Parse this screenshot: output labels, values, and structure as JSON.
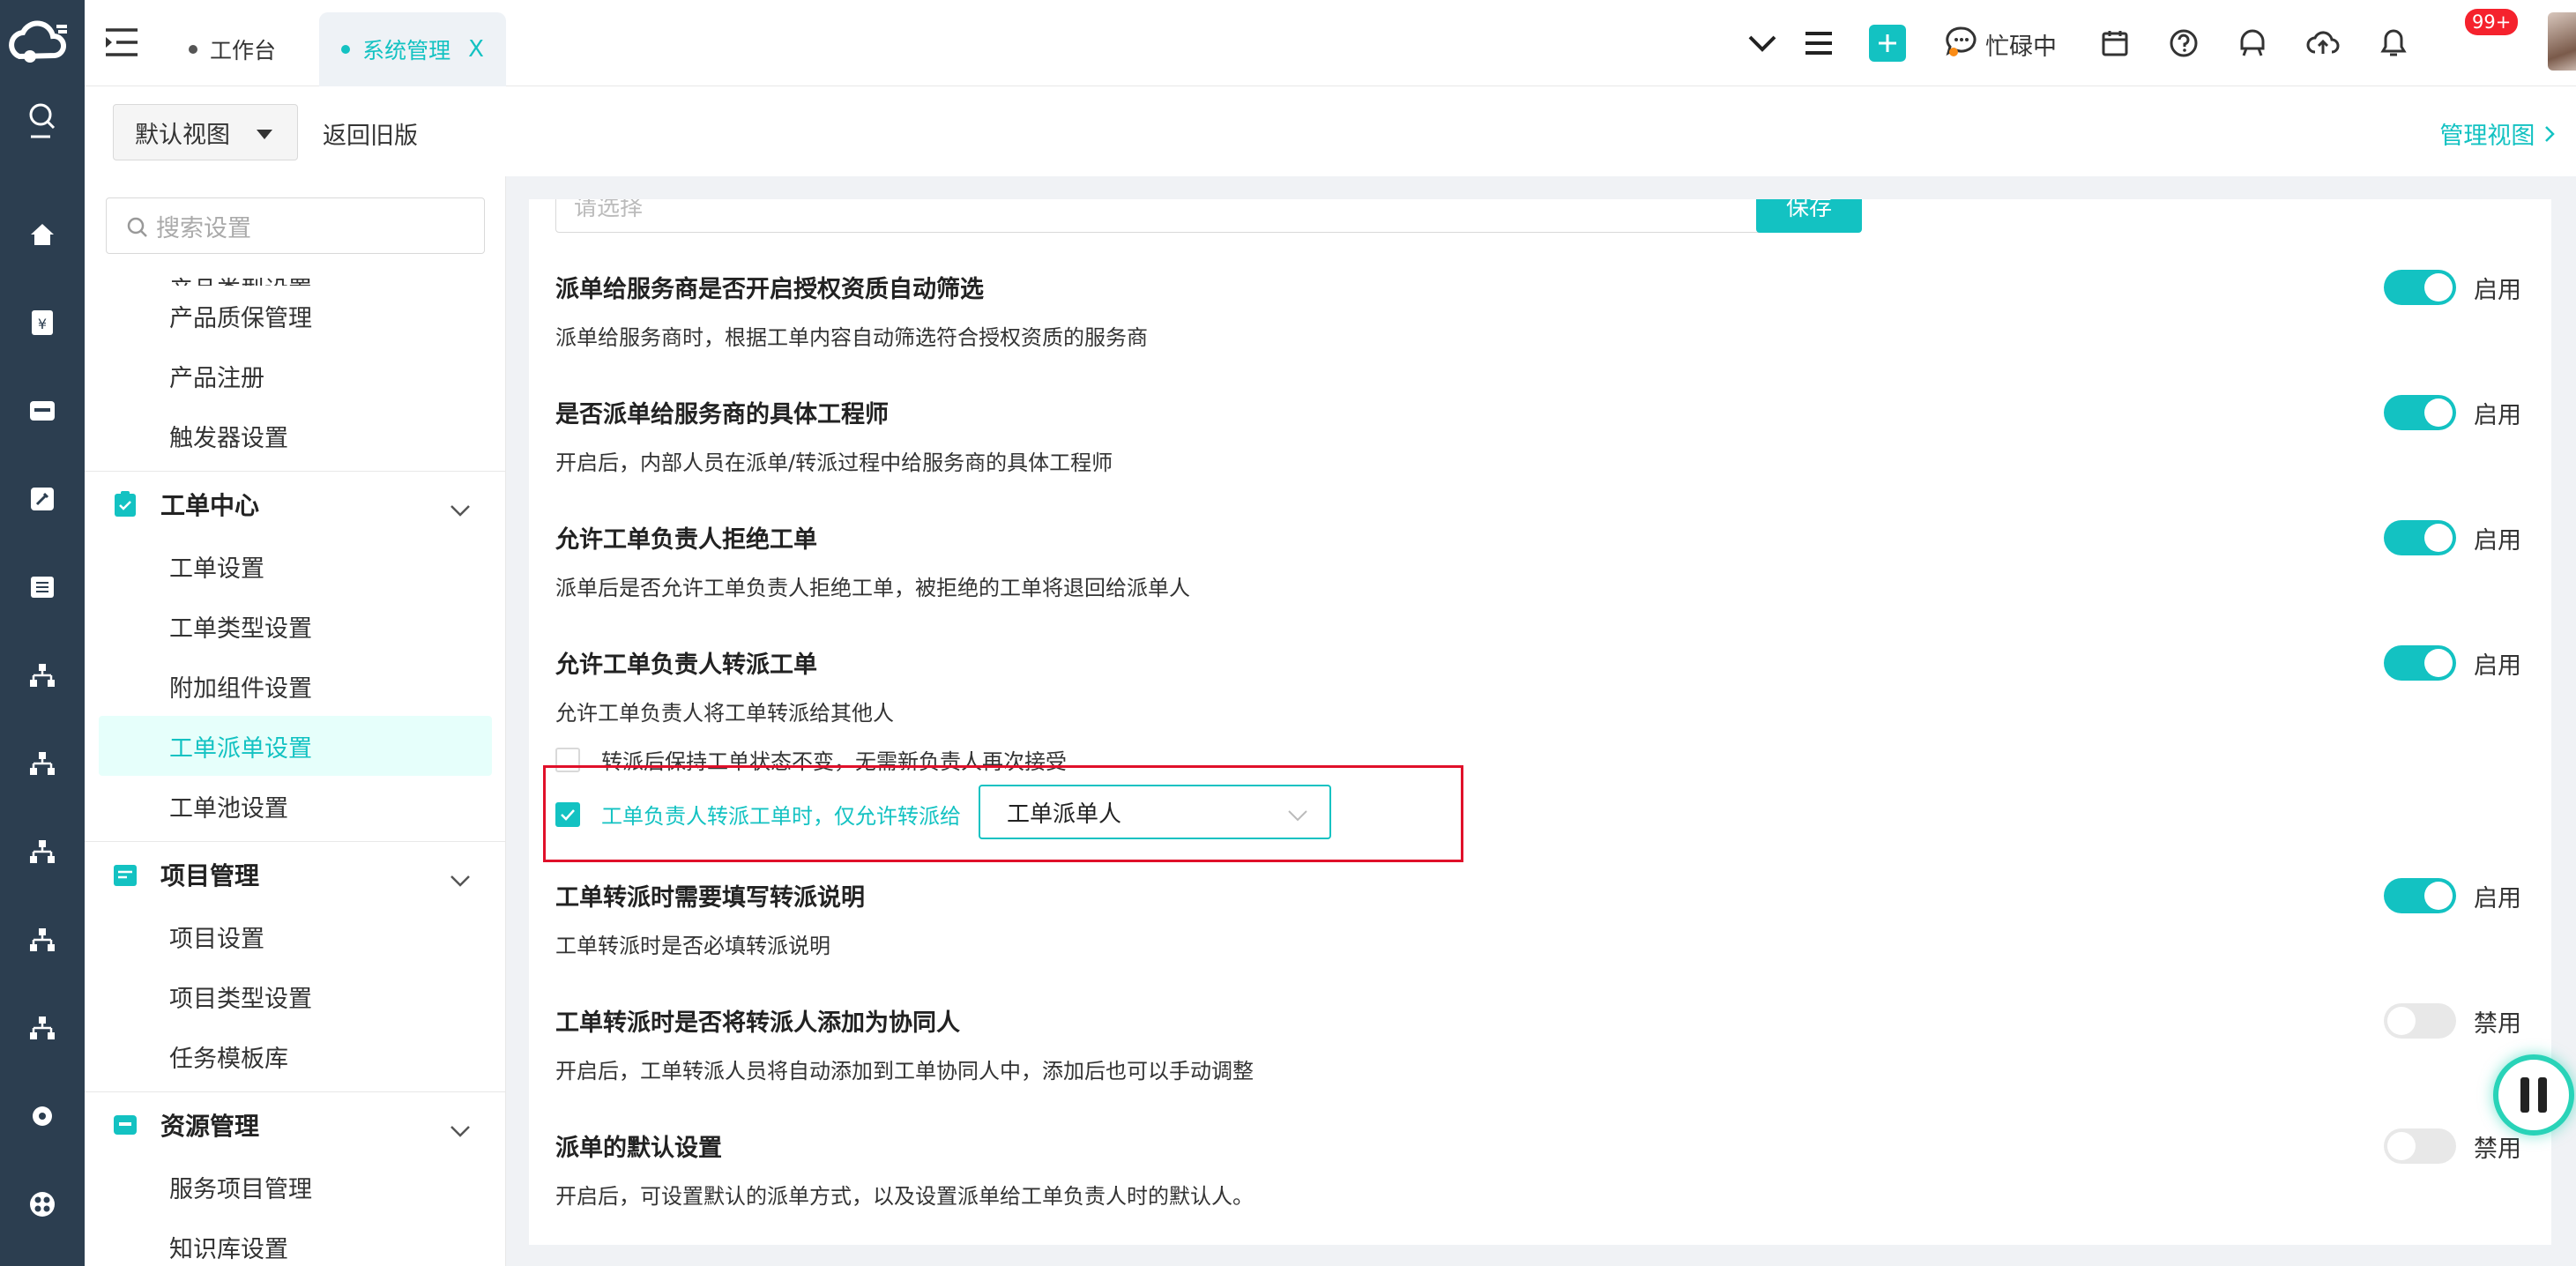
{
  "topbar": {
    "tabs": [
      {
        "label": "工作台"
      },
      {
        "label": "系统管理",
        "close": "X"
      }
    ],
    "status_label": "忙碌中",
    "notification_count": "99+"
  },
  "subheader": {
    "view_select": "默认视图",
    "back_link": "返回旧版",
    "manage_view": "管理视图"
  },
  "nav": {
    "search_placeholder": "搜索设置",
    "partial_item": "产品类型设置",
    "product_items": [
      "产品质保管理",
      "产品注册",
      "触发器设置"
    ],
    "groups": [
      {
        "label": "工单中心",
        "items": [
          "工单设置",
          "工单类型设置",
          "附加组件设置",
          "工单派单设置",
          "工单池设置"
        ]
      },
      {
        "label": "项目管理",
        "items": [
          "项目设置",
          "项目类型设置",
          "任务模板库"
        ]
      },
      {
        "label": "资源管理",
        "items": [
          "服务项目管理",
          "知识库设置"
        ]
      }
    ],
    "active_item": "工单派单设置"
  },
  "main": {
    "top_input_placeholder": "请选择",
    "save_label": "保存",
    "settings": [
      {
        "title": "派单给服务商是否开启授权资质自动筛选",
        "desc": "派单给服务商时，根据工单内容自动筛选符合授权资质的服务商",
        "state": "启用",
        "on": true
      },
      {
        "title": "是否派单给服务商的具体工程师",
        "desc": "开启后，内部人员在派单/转派过程中给服务商的具体工程师",
        "state": "启用",
        "on": true
      },
      {
        "title": "允许工单负责人拒绝工单",
        "desc": "派单后是否允许工单负责人拒绝工单，被拒绝的工单将退回给派单人",
        "state": "启用",
        "on": true
      },
      {
        "title": "允许工单负责人转派工单",
        "desc": "允许工单负责人将工单转派给其他人",
        "state": "启用",
        "on": true
      },
      {
        "title": "工单转派时需要填写转派说明",
        "desc": "工单转派时是否必填转派说明",
        "state": "启用",
        "on": true
      },
      {
        "title": "工单转派时是否将转派人添加为协同人",
        "desc": "开启后，工单转派人员将自动添加到工单协同人中，添加后也可以手动调整",
        "state": "禁用",
        "on": false
      },
      {
        "title": "派单的默认设置",
        "desc": "开启后，可设置默认的派单方式，以及设置派单给工单负责人时的默认人。",
        "state": "禁用",
        "on": false
      }
    ],
    "checkbox_keep_status": "转派后保持工单状态不变，无需新负责人再次接受",
    "checkbox_only_allow": "工单负责人转派工单时，仅允许转派给",
    "dropdown_value": "工单派单人"
  },
  "colors": {
    "accent": "#13c2c2",
    "rail": "#2c3e50",
    "highlight": "#e0102a",
    "badge": "#f5222d"
  }
}
